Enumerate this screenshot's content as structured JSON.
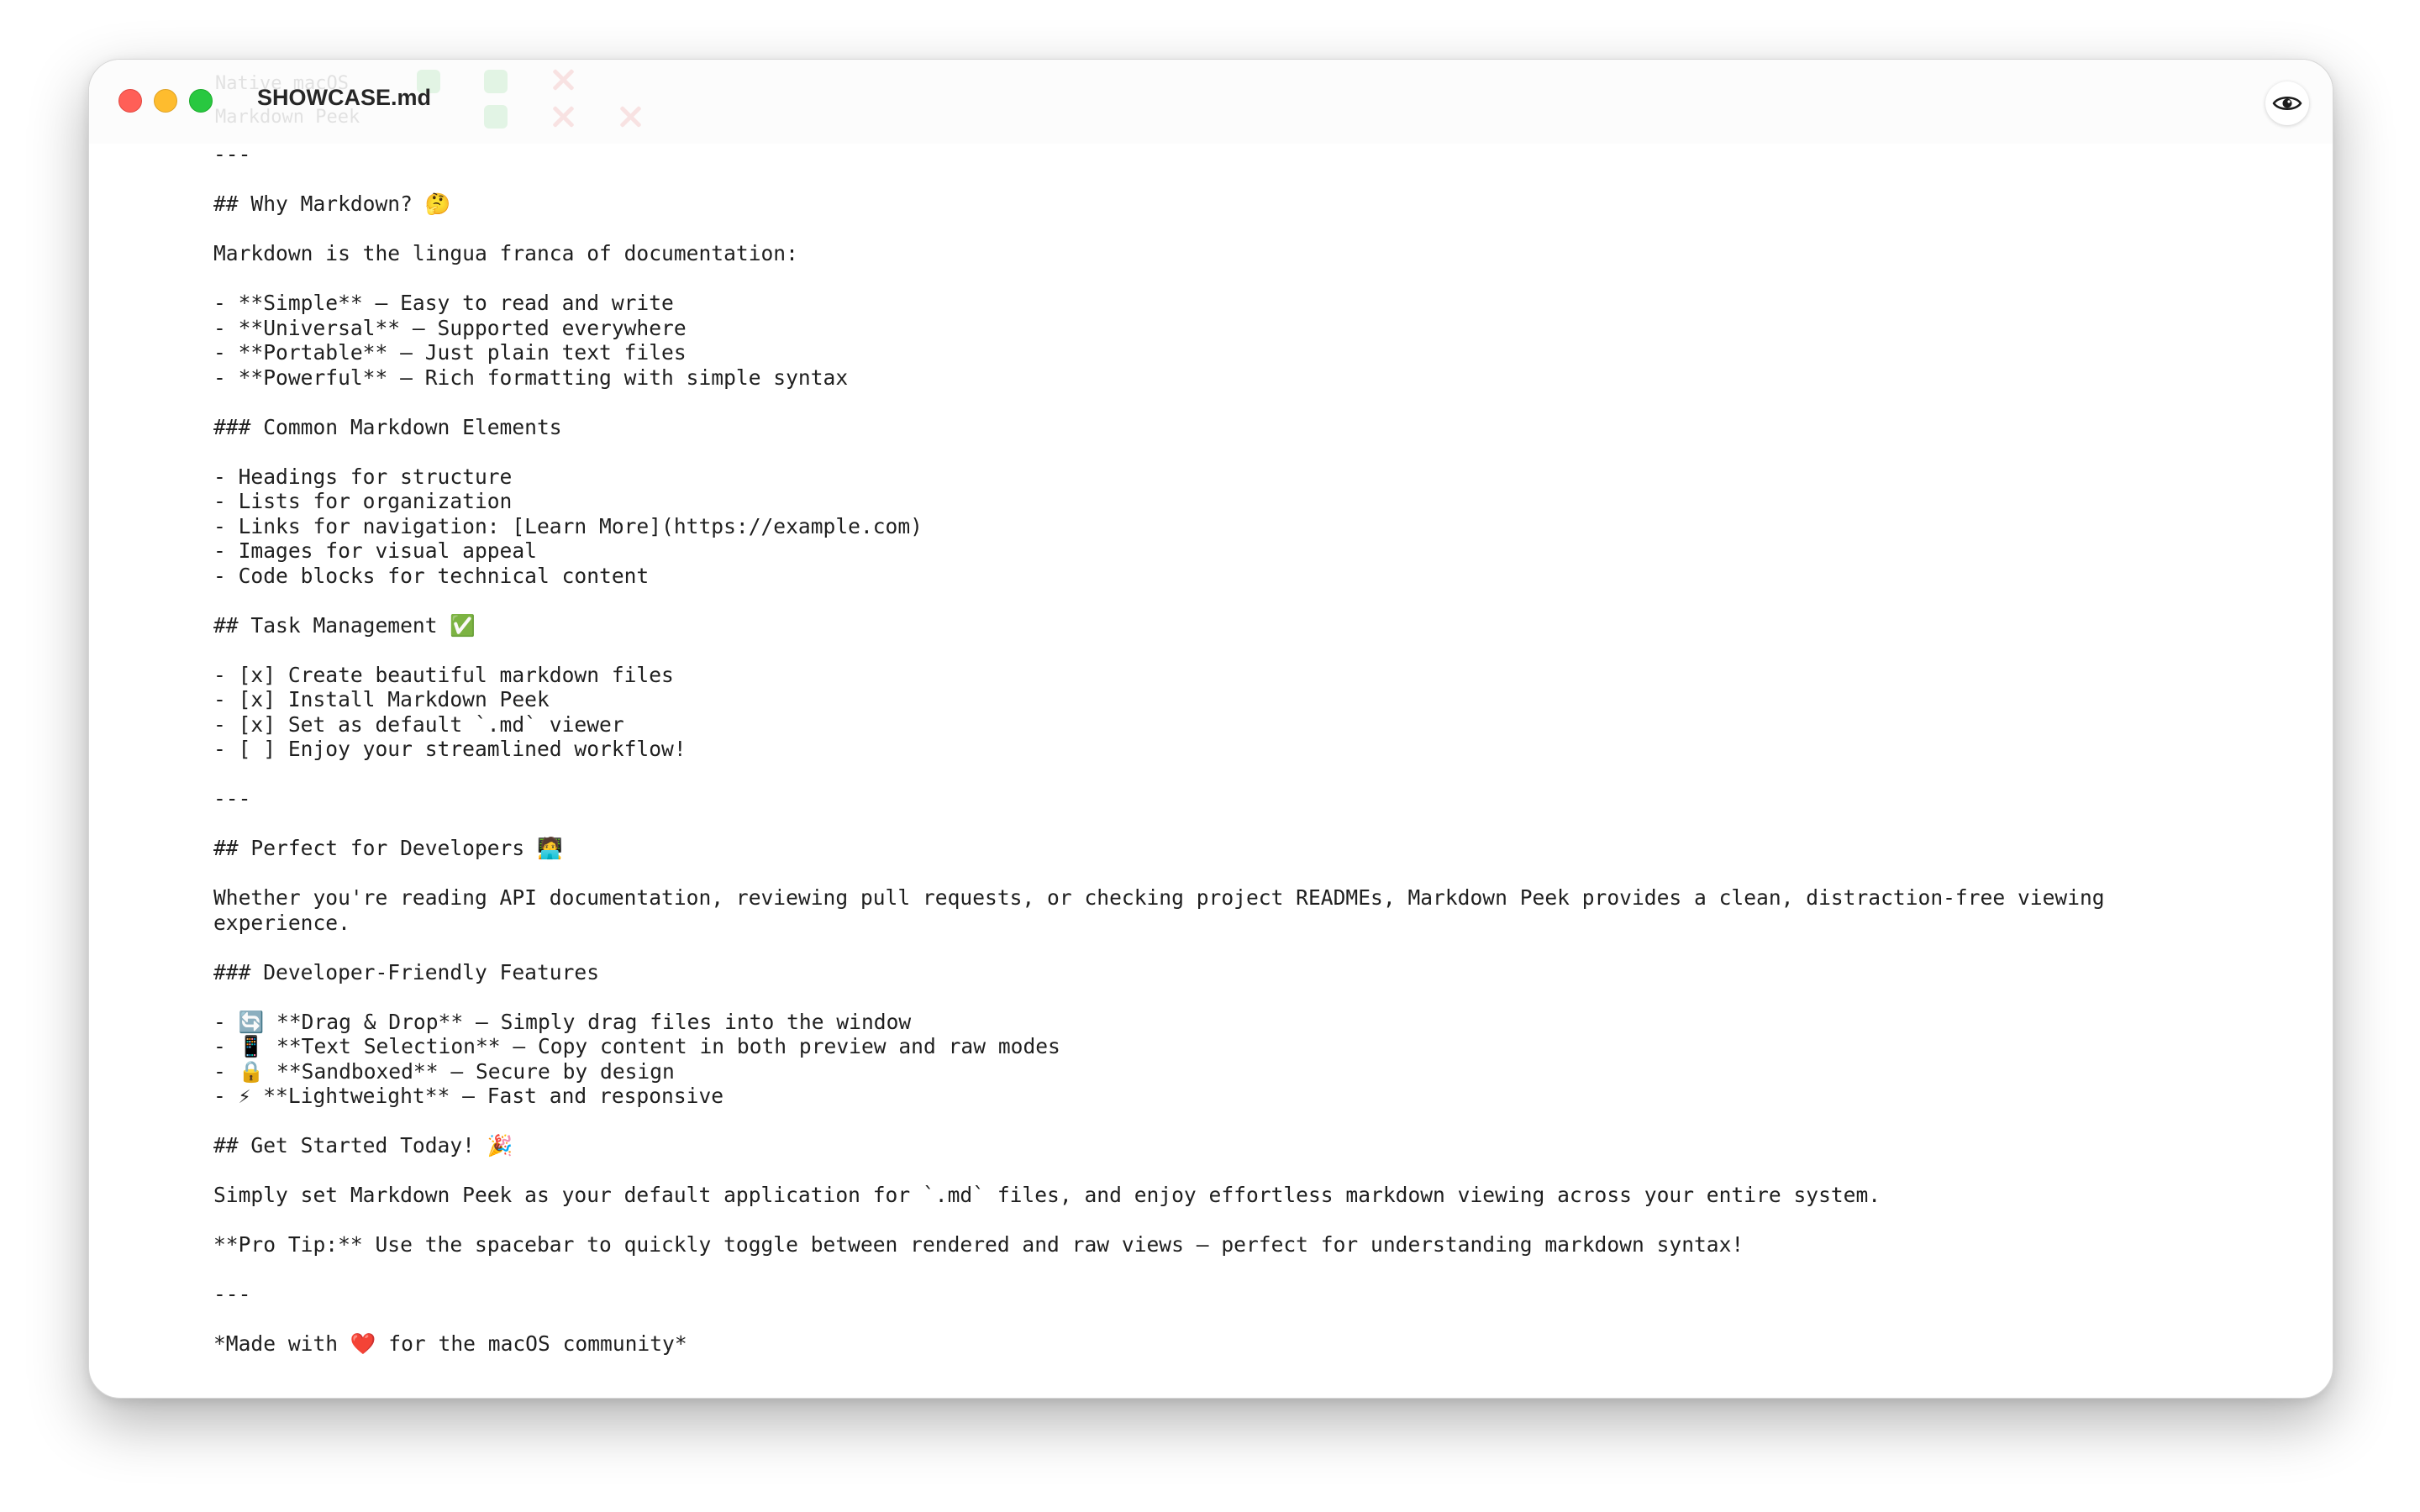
{
  "window": {
    "title": "SHOWCASE.md",
    "ghost_row1": "Native macOS",
    "ghost_row2": "Markdown Peek"
  },
  "toolbar": {
    "preview_toggle_icon": "eye-icon"
  },
  "document": {
    "hr1": "---",
    "h2_why": "## Why Markdown? 🤔",
    "p_lingua": "Markdown is the lingua franca of documentation:",
    "why_items": [
      "- **Simple** — Easy to read and write",
      "- **Universal** — Supported everywhere",
      "- **Portable** — Just plain text files",
      "- **Powerful** — Rich formatting with simple syntax"
    ],
    "h3_elements": "### Common Markdown Elements",
    "element_items": [
      "- Headings for structure",
      "- Lists for organization",
      "- Links for navigation: [Learn More](https://example.com)",
      "- Images for visual appeal",
      "- Code blocks for technical content"
    ],
    "h2_tasks": "## Task Management ✅",
    "task_items": [
      "- [x] Create beautiful markdown files",
      "- [x] Install Markdown Peek",
      "- [x] Set as default `.md` viewer",
      "- [ ] Enjoy your streamlined workflow!"
    ],
    "hr2": "---",
    "h2_devs": "## Perfect for Developers 🧑‍💻",
    "p_whether": "Whether you're reading API documentation, reviewing pull requests, or checking project READMEs, Markdown Peek provides a clean, distraction-free viewing experience.",
    "h3_devfeatures": "### Developer-Friendly Features",
    "dev_items": [
      "- 🔄 **Drag & Drop** — Simply drag files into the window",
      "- 📱 **Text Selection** — Copy content in both preview and raw modes",
      "- 🔒 **Sandboxed** — Secure by design",
      "- ⚡ **Lightweight** — Fast and responsive"
    ],
    "h2_start": "## Get Started Today! 🎉",
    "p_simply": "Simply set Markdown Peek as your default application for `.md` files, and enjoy effortless markdown viewing across your entire system.",
    "p_protip": "**Pro Tip:** Use the spacebar to quickly toggle between rendered and raw views — perfect for understanding markdown syntax!",
    "hr3": "---",
    "p_made": "*Made with ❤️ for the macOS community*"
  }
}
